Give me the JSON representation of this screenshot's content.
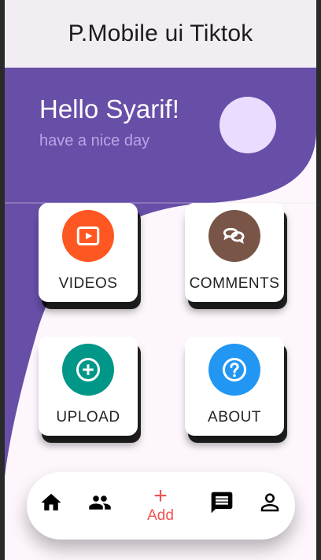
{
  "app": {
    "title": "P.Mobile ui Tiktok"
  },
  "header": {
    "greeting": "Hello Syarif!",
    "subtitle": "have a nice day"
  },
  "menu": [
    {
      "label": "VIDEOS",
      "icon": "play-icon",
      "color": "#ff5722"
    },
    {
      "label": "COMMENTS",
      "icon": "chat-bubbles-icon",
      "color": "#795548"
    },
    {
      "label": "UPLOAD",
      "icon": "plus-circle-icon",
      "color": "#009688"
    },
    {
      "label": "ABOUT",
      "icon": "question-circle-icon",
      "color": "#2196f3"
    }
  ],
  "nav": {
    "add_label": "Add",
    "add_icon": "+",
    "items": [
      {
        "icon": "home-icon"
      },
      {
        "icon": "people-icon"
      },
      {
        "icon": "add-icon"
      },
      {
        "icon": "message-icon"
      },
      {
        "icon": "person-icon"
      }
    ]
  },
  "colors": {
    "accent": "#674ea7",
    "appbar": "#f2edf2",
    "avatar": "#eadcff",
    "add": "#ef5350"
  }
}
